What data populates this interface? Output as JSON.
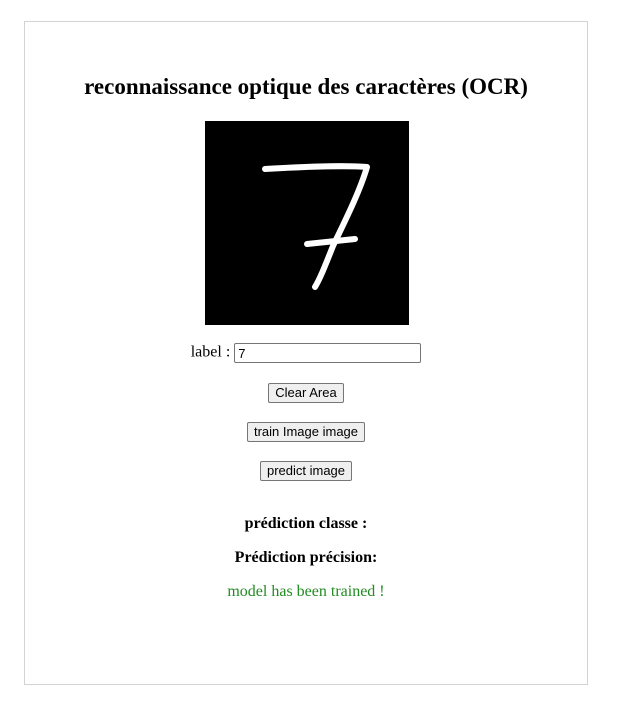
{
  "title": "reconnaissance optique des caractères (OCR)",
  "canvas": {
    "background": "#000000",
    "stroke_color": "#ffffff",
    "drawn_digit": "7"
  },
  "label_field": {
    "label": "label :",
    "value": "7"
  },
  "buttons": {
    "clear": "Clear Area",
    "train": "train Image image",
    "predict": "predict image"
  },
  "results": {
    "class_label": "prédiction classe :",
    "precision_label": "Prédiction précision:"
  },
  "status": {
    "message": "model has been trained !",
    "color": "#228b22"
  }
}
